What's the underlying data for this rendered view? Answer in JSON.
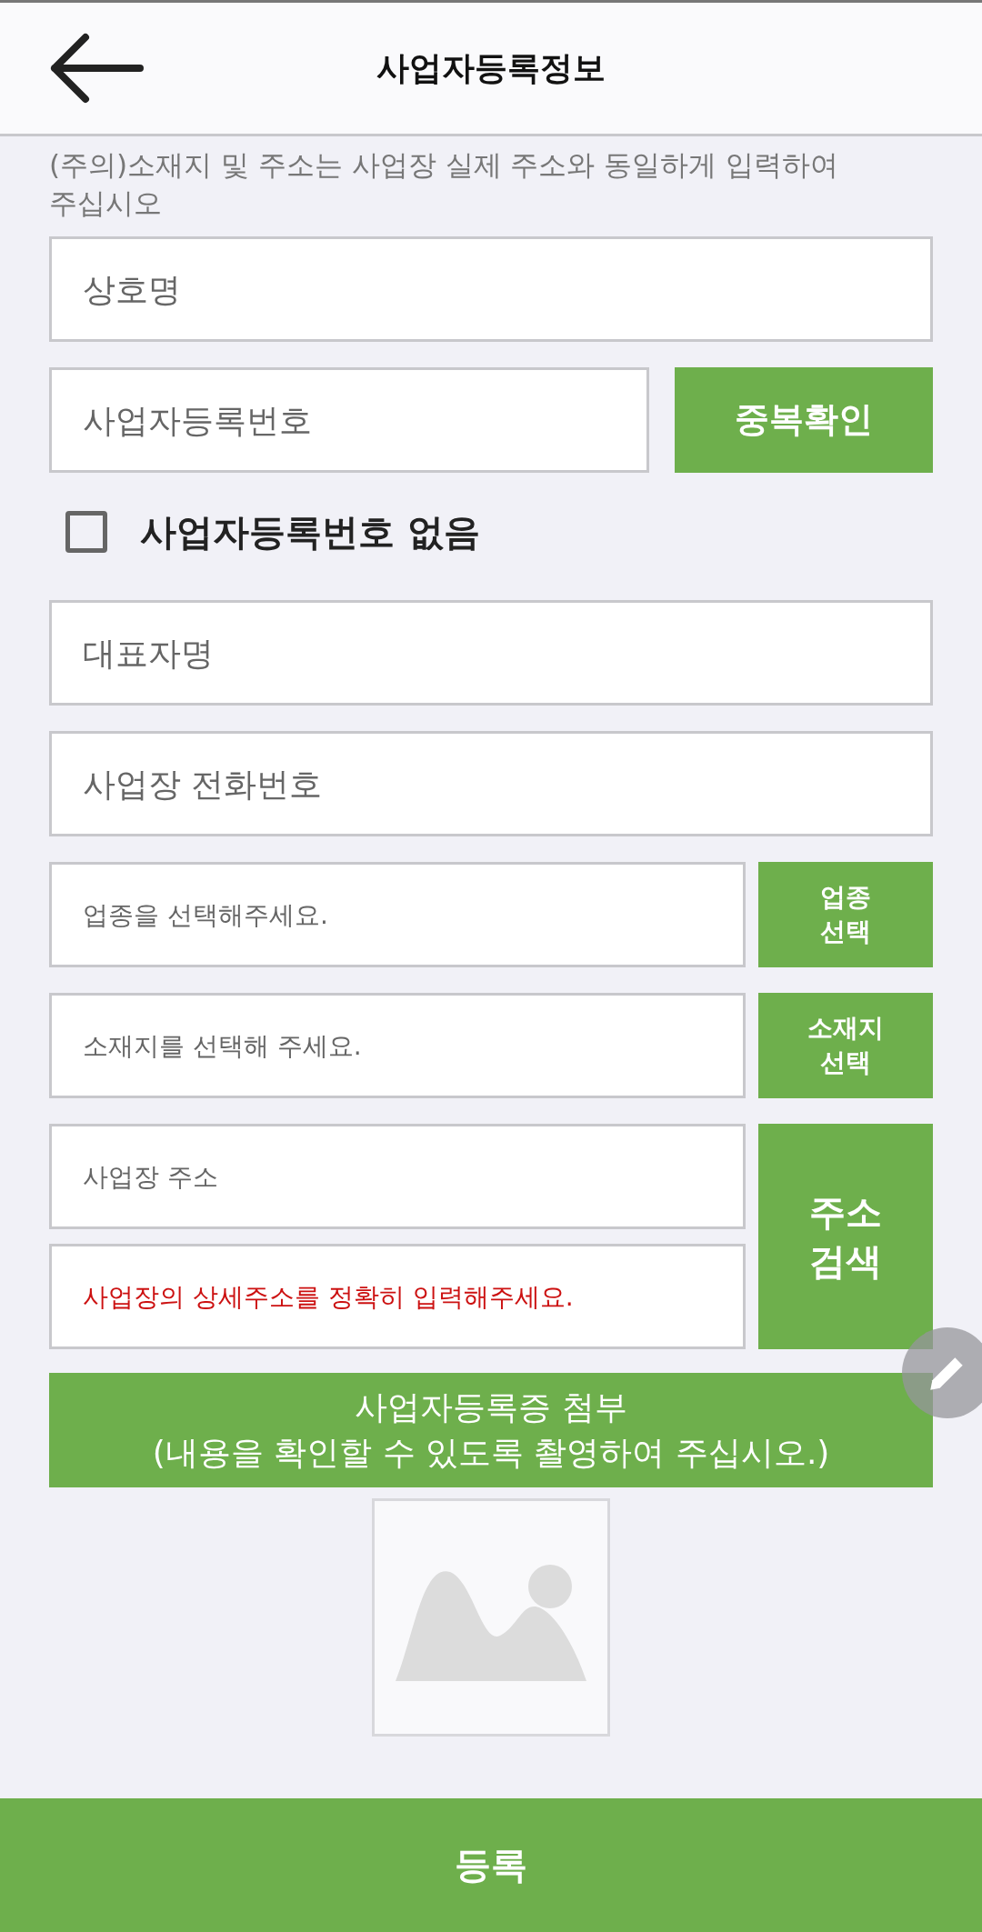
{
  "header": {
    "title": "사업자등록정보"
  },
  "notice": "(주의)소재지 및 주소는 사업장 실제 주소와 동일하게 입력하여 주십시오",
  "business_name": {
    "placeholder": "상호명"
  },
  "registration_number": {
    "placeholder": "사업자등록번호",
    "button": "중복확인"
  },
  "no_number": {
    "label": "사업자등록번호 없음",
    "checked": false
  },
  "representative": {
    "placeholder": "대표자명"
  },
  "phone": {
    "placeholder": "사업장 전화번호"
  },
  "industry": {
    "placeholder": "업종을 선택해주세요.",
    "button": "업종\n선택"
  },
  "location": {
    "placeholder": "소재지를 선택해 주세요.",
    "button": "소재지\n선택"
  },
  "address": {
    "fields": [
      {
        "placeholder": "사업장 주소",
        "kind": "plain"
      },
      {
        "placeholder": "사업장의 상세주소를 정확히 입력해주세요.",
        "kind": "warning"
      }
    ],
    "button": "주소\n검색"
  },
  "attach_button": "사업자등록증 첨부\n(내용을 확인할 수 있도록 촬영하여 주십시오.)",
  "image": {
    "kind": "placeholder"
  },
  "submit_button": "등록"
}
